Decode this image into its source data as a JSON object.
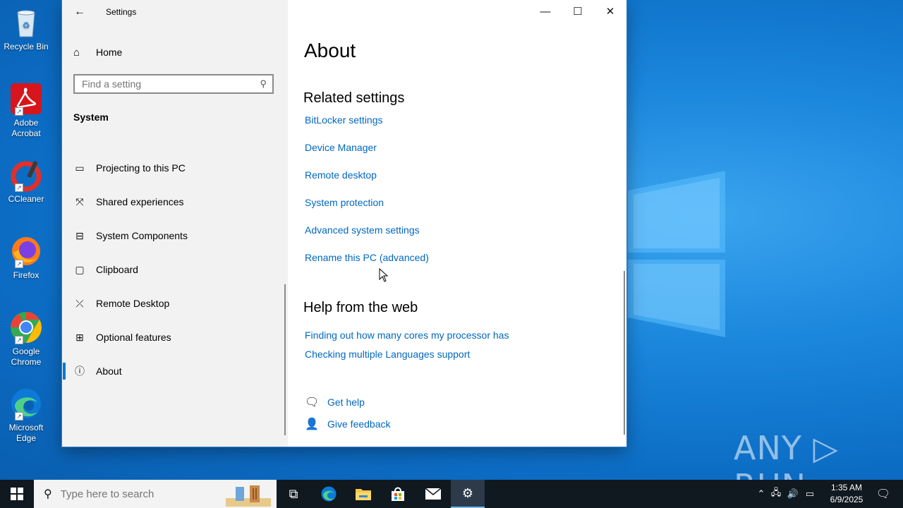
{
  "desktop": {
    "icons": [
      {
        "label": "Recycle Bin"
      },
      {
        "label": "Adobe Acrobat"
      },
      {
        "label": "CCleaner"
      },
      {
        "label": "Firefox"
      },
      {
        "label": "Google Chrome"
      },
      {
        "label": "Microsoft Edge"
      }
    ],
    "watermark": "ANY ▷ RUN"
  },
  "window": {
    "title": "Settings",
    "controls": {
      "minimize": "—",
      "maximize": "☐",
      "close": "✕"
    }
  },
  "sidebar": {
    "home_label": "Home",
    "search_placeholder": "Find a setting",
    "section_label": "System",
    "items": [
      {
        "label": "Projecting to this PC",
        "icon": "projector-icon"
      },
      {
        "label": "Shared experiences",
        "icon": "shared-experiences-icon"
      },
      {
        "label": "System Components",
        "icon": "components-icon"
      },
      {
        "label": "Clipboard",
        "icon": "clipboard-icon"
      },
      {
        "label": "Remote Desktop",
        "icon": "remote-desktop-icon"
      },
      {
        "label": "Optional features",
        "icon": "optional-features-icon"
      },
      {
        "label": "About",
        "icon": "info-icon",
        "active": true
      }
    ]
  },
  "main": {
    "page_title": "About",
    "related_heading": "Related settings",
    "related_links": [
      "BitLocker settings",
      "Device Manager",
      "Remote desktop",
      "System protection",
      "Advanced system settings",
      "Rename this PC (advanced)"
    ],
    "help_heading": "Help from the web",
    "help_links": [
      "Finding out how many cores my processor has",
      "Checking multiple Languages support"
    ],
    "get_help": "Get help",
    "give_feedback": "Give feedback"
  },
  "taskbar": {
    "search_placeholder": "Type here to search",
    "clock_time": "1:35 AM",
    "clock_date": "6/9/2025"
  }
}
